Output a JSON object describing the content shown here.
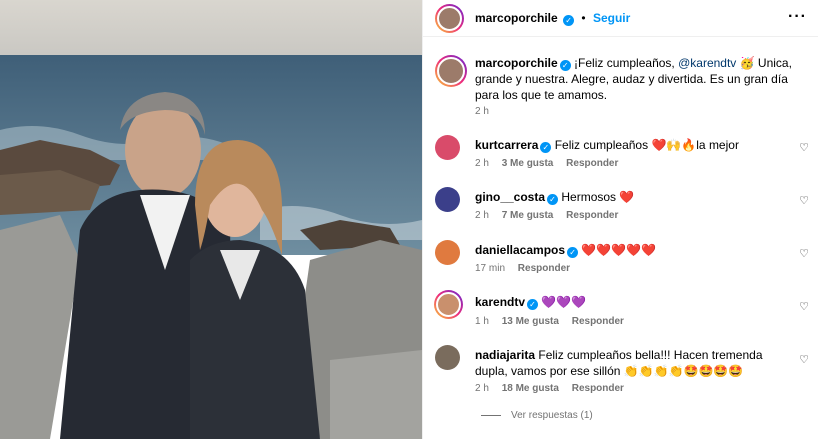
{
  "post": {
    "author": "marcoporchile",
    "follow_label": "Seguir",
    "more_icon": "more-horizontal-icon",
    "caption_pre": "¡Feliz cumpleaños, ",
    "caption_mention": "@karendtv",
    "caption_post": " 🥳 Unica, grande y nuestra. Alegre, audaz y divertida. Es un gran día para los que te amamos.",
    "caption_time": "2 h"
  },
  "comments": [
    {
      "user": "kurtcarrera",
      "verified": true,
      "text": "Feliz cumpleaños ",
      "emoji": "❤️🙌🔥",
      "tail": "la mejor",
      "time": "2 h",
      "likes": "3 Me gusta",
      "reply": "Responder"
    },
    {
      "user": "gino__costa",
      "verified": true,
      "text": "Hermosos ",
      "emoji": "❤️",
      "tail": "",
      "time": "2 h",
      "likes": "7 Me gusta",
      "reply": "Responder"
    },
    {
      "user": "daniellacampos",
      "verified": true,
      "text": "",
      "emoji": "❤️❤️❤️❤️❤️",
      "tail": "",
      "time": "17 min",
      "likes": "",
      "reply": "Responder"
    },
    {
      "user": "karendtv",
      "verified": true,
      "text": "",
      "emoji": "💜💜💜",
      "tail": "",
      "time": "1 h",
      "likes": "13 Me gusta",
      "reply": "Responder"
    },
    {
      "user": "nadiajarita",
      "verified": false,
      "text": "Feliz cumpleaños bella!!! Hacen tremenda dupla, vamos por ese sillón ",
      "emoji": "👏👏👏👏🤩🤩🤩🤩",
      "tail": "",
      "time": "2 h",
      "likes": "18 Me gusta",
      "reply": "Responder"
    }
  ],
  "view_replies": "Ver respuestas (1)",
  "colors": {
    "accent": "#0095f6",
    "verified": "#0095f6",
    "muted": "#737373"
  }
}
